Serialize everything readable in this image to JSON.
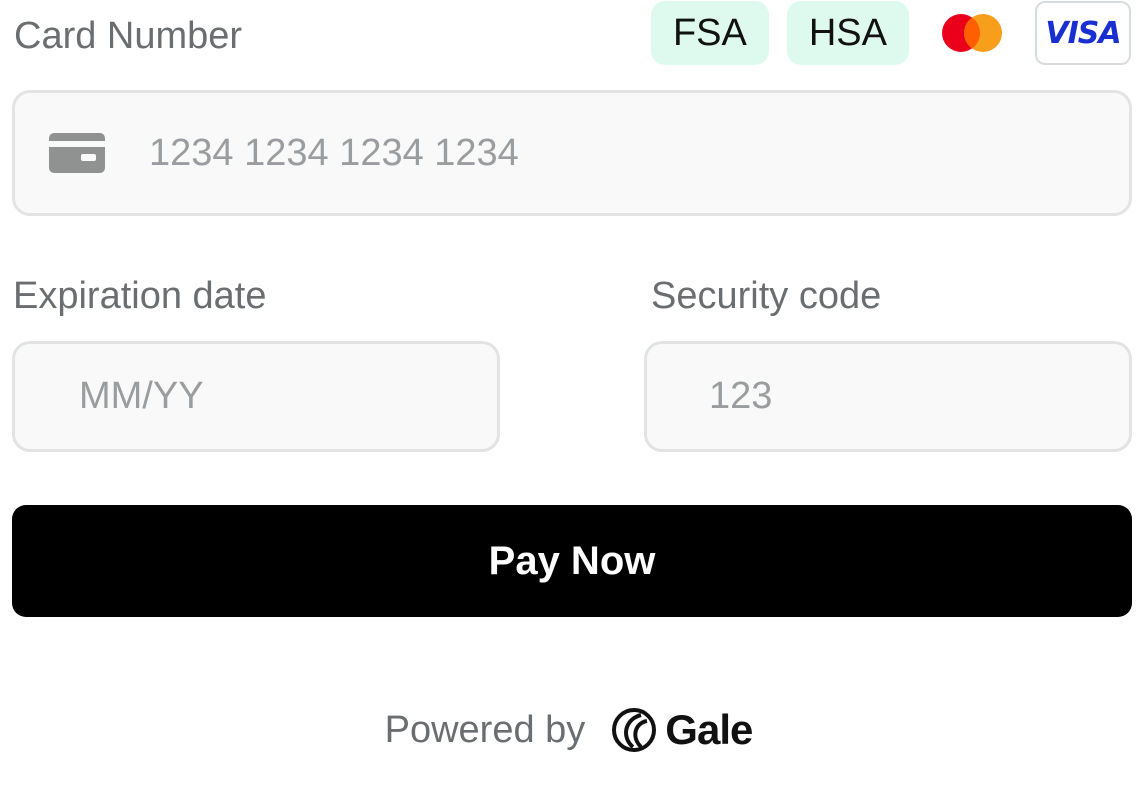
{
  "card_number": {
    "label": "Card Number",
    "placeholder": "1234 1234 1234 1234",
    "badges": [
      "FSA",
      "HSA"
    ],
    "visa_label": "VISA"
  },
  "expiration": {
    "label": "Expiration date",
    "placeholder": "MM/YY"
  },
  "security": {
    "label": "Security code",
    "placeholder": "123"
  },
  "pay_button": "Pay Now",
  "footer": {
    "powered_by": "Powered by",
    "brand": "Gale"
  },
  "colors": {
    "badge_bg": "#defaef",
    "button_bg": "#000000",
    "mc_red": "#eb001b",
    "mc_orange": "#f79e1b",
    "visa_blue": "#1a2fd1"
  },
  "icons": [
    "card-icon",
    "mastercard-icon",
    "visa-icon",
    "gale-logo-icon"
  ]
}
